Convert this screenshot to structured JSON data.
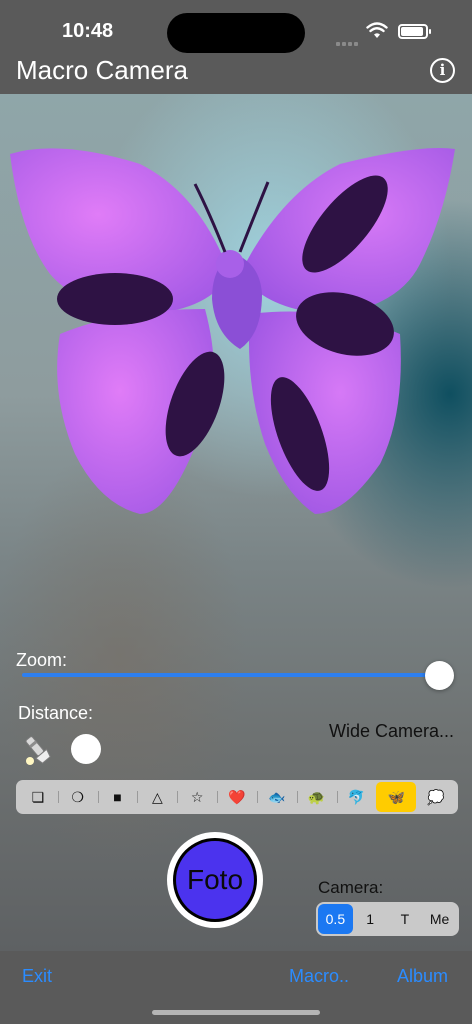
{
  "status": {
    "time": "10:48"
  },
  "nav": {
    "title": "Macro Camera",
    "info_icon": "info-icon"
  },
  "controls": {
    "zoom_label": "Zoom:",
    "zoom_level": 1.0,
    "distance_label": "Distance:",
    "wide_camera": "Wide Camera...",
    "flashlight_icon": "flashlight-icon"
  },
  "shapes": {
    "items": [
      "❏",
      "❍",
      "■",
      "△",
      "☆",
      "❤️",
      "🐟",
      "🐢",
      "🐬",
      "🦋",
      "💭"
    ],
    "selected_index": 9
  },
  "capture": {
    "button_label": "Foto"
  },
  "camera": {
    "label": "Camera:",
    "options": [
      "0.5",
      "1",
      "T",
      "Me"
    ],
    "selected_index": 0
  },
  "bottom": {
    "exit": "Exit",
    "macro": "Macro..",
    "album": "Album"
  },
  "colors": {
    "accent": "#1b78f2",
    "link": "#2b8cff",
    "capture": "#4b33ee",
    "highlight": "#ffcc00",
    "butterfly": "#b85ef2"
  }
}
